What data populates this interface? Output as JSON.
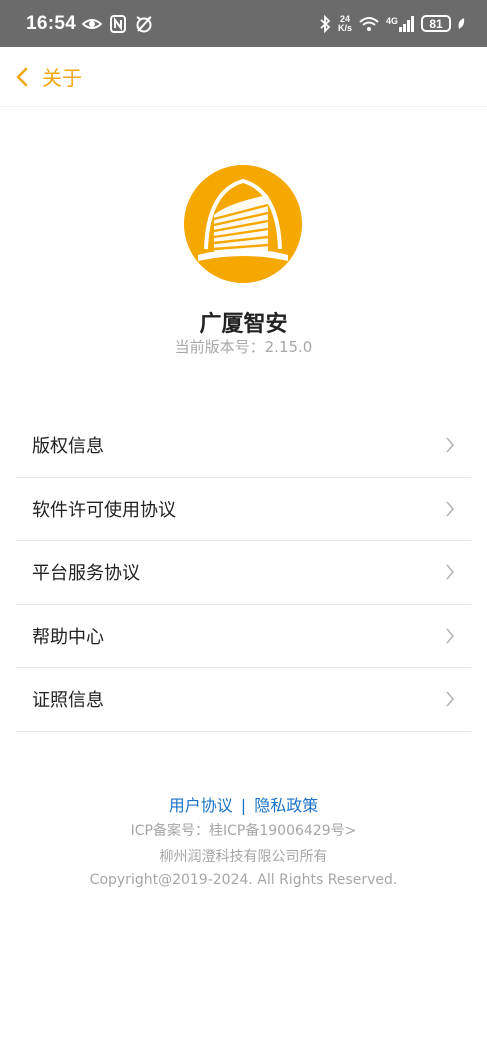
{
  "status_bar": {
    "time": "16:54",
    "net_speed_value": "24",
    "net_speed_unit": "K/s",
    "network": "4G",
    "battery": "81"
  },
  "nav": {
    "title": "关于"
  },
  "app": {
    "name": "广厦智安",
    "version": "当前版本号：2.15.0",
    "logo_color": "#f5a800"
  },
  "menu": {
    "items": [
      {
        "label": "版权信息"
      },
      {
        "label": "软件许可使用协议"
      },
      {
        "label": "平台服务协议"
      },
      {
        "label": "帮助中心"
      },
      {
        "label": "证照信息"
      }
    ]
  },
  "footer": {
    "user_agreement": "用户协议",
    "separator": "|",
    "privacy_policy": "隐私政策",
    "icp": "ICP备案号：桂ICP备19006429号>",
    "company": "柳州润澄科技有限公司所有",
    "copyright": "Copyright@2019-2024. All Rights Reserved."
  },
  "colors": {
    "accent": "#f2a810",
    "link": "#1a73c8",
    "status_bar": "#6b6b6b"
  }
}
